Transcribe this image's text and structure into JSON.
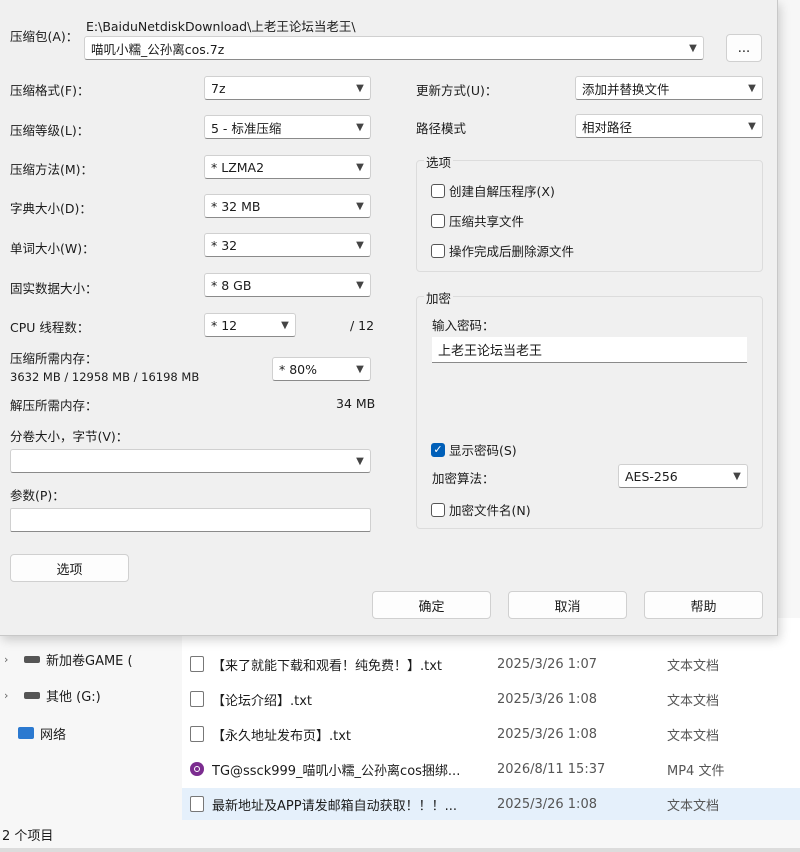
{
  "explorer": {
    "nav": [
      {
        "label": "新加卷GAME (",
        "icon": "drive-icon"
      },
      {
        "label": "其他 (G:)",
        "icon": "drive-icon"
      },
      {
        "label": "网络",
        "icon": "network-icon"
      }
    ],
    "files": [
      {
        "name": "【来了就能下载和观看！纯免费！】.txt",
        "date": "2025/3/26 1:07",
        "type": "文本文档",
        "icon": "text-file-icon"
      },
      {
        "name": "【论坛介绍】.txt",
        "date": "2025/3/26 1:08",
        "type": "文本文档",
        "icon": "text-file-icon"
      },
      {
        "name": "【永久地址发布页】.txt",
        "date": "2025/3/26 1:08",
        "type": "文本文档",
        "icon": "text-file-icon"
      },
      {
        "name": "TG@ssck999_喵叽小糯_公孙离cos捆绑...",
        "date": "2026/8/11 15:37",
        "type": "MP4 文件",
        "icon": "video-file-icon"
      },
      {
        "name": "最新地址及APP请发邮箱自动获取！！！...",
        "date": "2025/3/26 1:08",
        "type": "文本文档",
        "icon": "text-file-icon"
      }
    ],
    "status": "2 个项目"
  },
  "dialog": {
    "archive_label": "压缩包(A)：",
    "archive_path": "E:\\BaiduNetdiskDownload\\上老王论坛当老王\\",
    "archive_name": "喵叽小糯_公孙离cos.7z",
    "browse_label": "...",
    "format_label": "压缩格式(F)：",
    "format_value": "7z",
    "level_label": "压缩等级(L)：",
    "level_value": "5 - 标准压缩",
    "method_label": "压缩方法(M)：",
    "method_value": "* LZMA2",
    "dict_label": "字典大小(D)：",
    "dict_value": "* 32 MB",
    "word_label": "单词大小(W)：",
    "word_value": "* 32",
    "solid_label": "固实数据大小：",
    "solid_value": "* 8 GB",
    "cpu_label": "CPU 线程数：",
    "cpu_value": "* 12",
    "cpu_max": "/ 12",
    "mem_comp_label": "压缩所需内存：",
    "mem_comp_detail": "3632 MB / 12958 MB / 16198 MB",
    "mem_percent": "* 80%",
    "mem_decomp_label": "解压所需内存：",
    "mem_decomp_value": "34 MB",
    "split_label": "分卷大小，字节(V)：",
    "split_value": "",
    "params_label": "参数(P)：",
    "params_value": "",
    "options_button": "选项",
    "update_label": "更新方式(U)：",
    "update_value": "添加并替换文件",
    "path_label": "路径模式",
    "path_value": "相对路径",
    "options_group": "选项",
    "opt_sfx": "创建自解压程序(X)",
    "opt_shared": "压缩共享文件",
    "opt_delete": "操作完成后删除源文件",
    "encrypt_group": "加密",
    "pwd_label": "输入密码：",
    "pwd_value": "上老王论坛当老王",
    "show_pwd": "显示密码(S)",
    "enc_method_label": "加密算法：",
    "enc_method_value": "AES-256",
    "enc_names": "加密文件名(N)",
    "ok": "确定",
    "cancel": "取消",
    "help": "帮助"
  }
}
